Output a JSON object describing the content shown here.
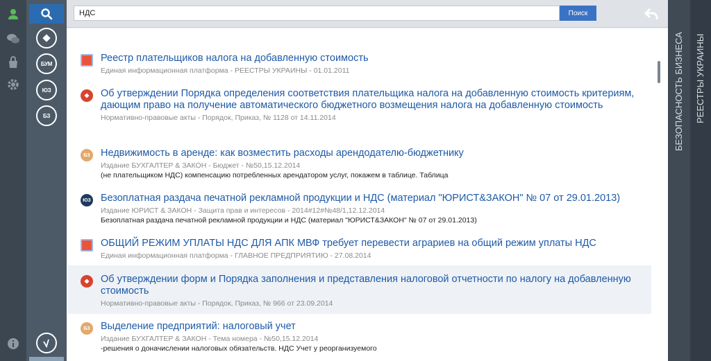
{
  "search": {
    "query": "НДС",
    "button_label": "Поиск"
  },
  "col2": {
    "circles": [
      "",
      "БУМ",
      "ЮЗ",
      "БЗ"
    ]
  },
  "right_tabs": {
    "tab1": "БЕЗОПАСНОСТЬ БИЗНЕСА",
    "tab2": "РЕЕСТРЫ УКРАИНЫ"
  },
  "results": [
    {
      "badge": "",
      "title": "Реестр плательщиков налога на добавленную стоимость",
      "meta": "Единая информационная платформа - РЕЕСТРЫ УКРАИНЫ - 01.01.2011",
      "snippet": ""
    },
    {
      "badge": "",
      "title": "Об утверждении Порядка определения соответствия плательщика налога на добавленную стоимость критериям, дающим право на получение автоматического бюджетного возмещения налога на добавленную стоимость",
      "meta": "Нормативно-правовые акты - Порядок, Приказ, № 1128 от 14.11.2014",
      "snippet": ""
    },
    {
      "badge": "БЗ",
      "title": "Недвижимость в аренде: как возместить расходы арендодателю-бюджетнику",
      "meta": "Издание БУХГАЛТЕР & ЗАКОН - Бюджет - №50,15.12.2014",
      "snippet": "(не плательщиком НДС) компенсацию потребленных арендатором услуг, покажем в таблице. Таблица"
    },
    {
      "badge": "ЮЗ",
      "title": "Безоплатная раздача печатной рекламной продукции и НДС (материал \"ЮРИСТ&ЗАКОН\" № 07 от 29.01.2013)",
      "meta": "Издание ЮРИСТ & ЗАКОН - Защита прав и интересов - 2014#12#№48/1,12.12.2014",
      "snippet": "Безоплатная раздача печатной рекламной продукции и НДС (материал \"ЮРИСТ&ЗАКОН\" № 07 от 29.01.2013)"
    },
    {
      "badge": "",
      "title": "ОБЩИЙ РЕЖИМ УПЛАТЫ НДС ДЛЯ АПК МВФ требует перевести аграриев на общий режим уплаты НДС",
      "meta": "Единая информационная платформа - ГЛАВНОЕ ПРЕДПРИЯТИЮ - 27.08.2014",
      "snippet": ""
    },
    {
      "badge": "",
      "title": "Об утверждении форм и Порядка заполнения и представления налоговой отчетности по налогу на добавленную стоимость",
      "meta": "Нормативно-правовые акты - Порядок, Приказ, № 966 от 23.09.2014",
      "snippet": ""
    },
    {
      "badge": "БЗ",
      "title": "Выделение предприятий: налоговый учет",
      "meta": "Издание БУХГАЛТЕР & ЗАКОН - Тема номера - №50,15.12.2014",
      "snippet": "-решения о доначислении налоговых обязательств. НДС Учет у реорганизуемого"
    }
  ]
}
